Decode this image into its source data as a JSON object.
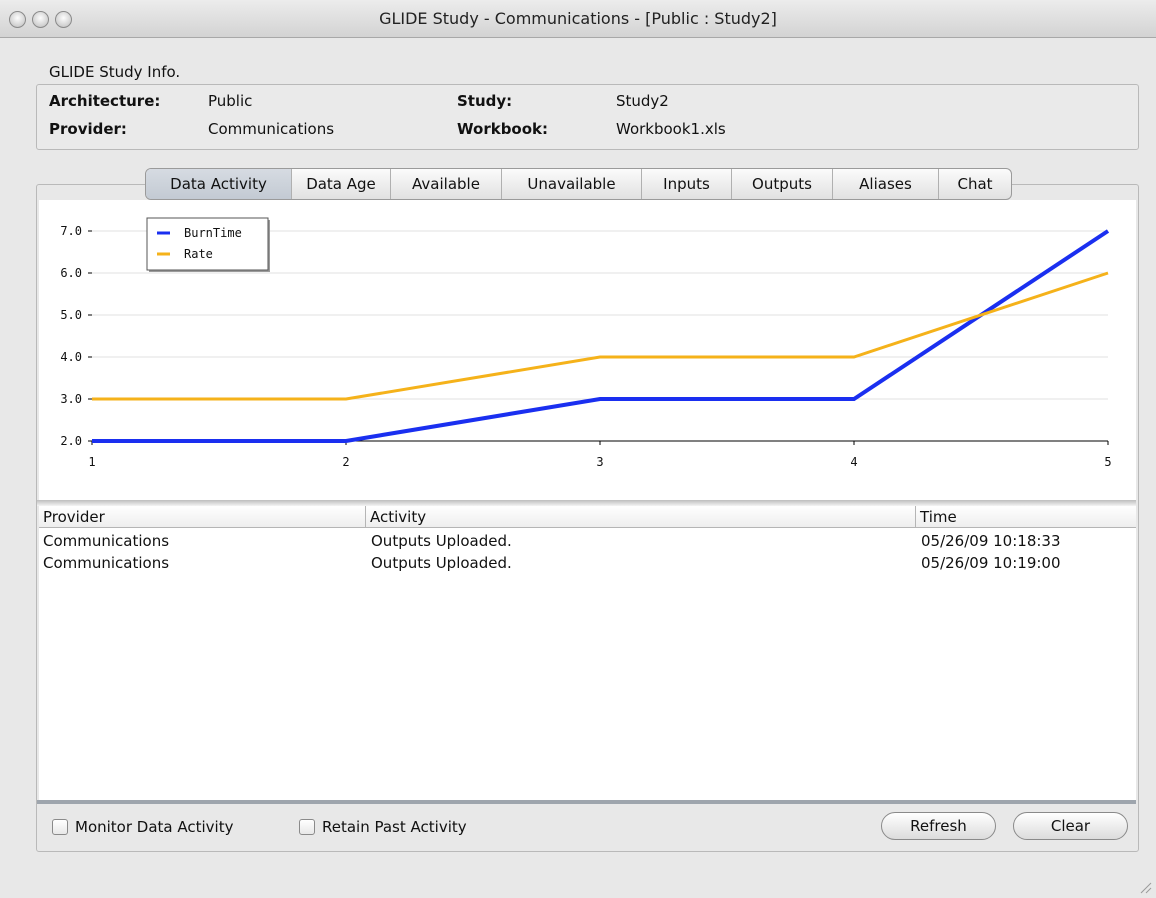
{
  "window": {
    "title": "GLIDE Study - Communications - [Public : Study2]"
  },
  "study_info": {
    "label": "GLIDE Study Info.",
    "architecture_key": "Architecture:",
    "architecture_value": "Public",
    "provider_key": "Provider:",
    "provider_value": "Communications",
    "study_key": "Study:",
    "study_value": "Study2",
    "workbook_key": "Workbook:",
    "workbook_value": "Workbook1.xls"
  },
  "tabs": [
    {
      "label": "Data Activity",
      "active": true
    },
    {
      "label": "Data Age"
    },
    {
      "label": "Available"
    },
    {
      "label": "Unavailable"
    },
    {
      "label": "Inputs"
    },
    {
      "label": "Outputs"
    },
    {
      "label": "Aliases"
    },
    {
      "label": "Chat"
    }
  ],
  "chart_data": {
    "type": "line",
    "x": [
      1,
      2,
      3,
      4,
      5
    ],
    "series": [
      {
        "name": "BurnTime",
        "values": [
          2,
          2,
          3,
          3,
          7
        ],
        "color": "#1a2ff0"
      },
      {
        "name": "Rate",
        "values": [
          3,
          3,
          4,
          4,
          6
        ],
        "color": "#f5b21a"
      }
    ],
    "xticks": [
      "1",
      "2",
      "3",
      "4",
      "5"
    ],
    "yticks": [
      "2.0",
      "3.0",
      "4.0",
      "5.0",
      "6.0",
      "7.0"
    ],
    "xlim": [
      1,
      5
    ],
    "ylim": [
      2,
      7
    ],
    "legend": "top-left",
    "grid": true
  },
  "activity_table": {
    "columns": [
      "Provider",
      "Activity",
      "Time"
    ],
    "rows": [
      [
        "Communications",
        "Outputs Uploaded.",
        "05/26/09 10:18:33"
      ],
      [
        "Communications",
        "Outputs Uploaded.",
        "05/26/09 10:19:00"
      ]
    ]
  },
  "controls": {
    "monitor_label": "Monitor Data Activity",
    "monitor_checked": false,
    "retain_label": "Retain Past Activity",
    "retain_checked": false,
    "refresh_label": "Refresh",
    "clear_label": "Clear"
  }
}
